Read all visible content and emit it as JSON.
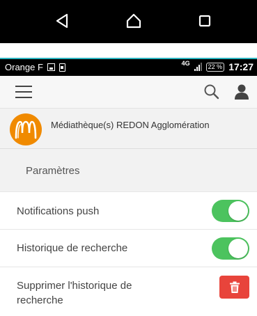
{
  "status_bar": {
    "carrier": "Orange F",
    "network": "4G",
    "battery": "22 %",
    "time": "17:27"
  },
  "library": {
    "name": "Médiathèque(s) REDON Agglomération"
  },
  "settings": {
    "title": "Paramètres",
    "items": [
      {
        "label": "Notifications push",
        "control": "toggle",
        "enabled": true
      },
      {
        "label": "Historique de recherche",
        "control": "toggle",
        "enabled": true
      },
      {
        "label": "Supprimer l'historique de recherche",
        "control": "delete-button"
      }
    ]
  },
  "colors": {
    "toggle_on": "#4cc35e",
    "delete_button": "#e8443b",
    "logo": "#f08a00",
    "accent_line": "#2bb3c0"
  },
  "icons": [
    "back-icon",
    "home-icon",
    "recent-apps-icon",
    "menu-icon",
    "search-icon",
    "user-icon",
    "trash-icon"
  ]
}
